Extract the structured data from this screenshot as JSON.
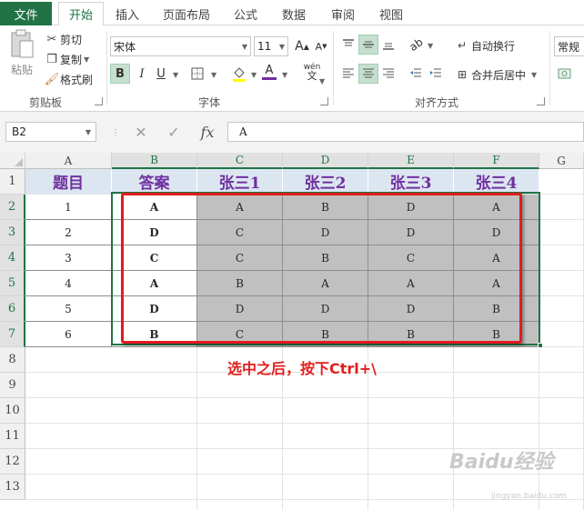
{
  "tabs": [
    "文件",
    "开始",
    "插入",
    "页面布局",
    "公式",
    "数据",
    "审阅",
    "视图"
  ],
  "active_tab": "开始",
  "clipboard": {
    "paste_label": "粘贴",
    "cut_label": "剪切",
    "copy_label": "复制",
    "format_painter_label": "格式刷",
    "group_label": "剪贴板"
  },
  "font": {
    "font_name": "宋体",
    "font_size": "11",
    "bold": "B",
    "italic": "I",
    "underline": "U",
    "grow": "A",
    "shrink": "A",
    "font_color_glyph": "A",
    "phonetic_glyph": "wén",
    "phonetic_sub": "文",
    "group_label": "字体"
  },
  "alignment": {
    "wrap_text_label": "自动换行",
    "merge_center_label": "合并后居中",
    "group_label": "对齐方式"
  },
  "number": {
    "format_label": "常规"
  },
  "formula_bar": {
    "name_box": "B2",
    "fx": "fx",
    "content": "A"
  },
  "columns": [
    "A",
    "B",
    "C",
    "D",
    "E",
    "F",
    "G"
  ],
  "rows": [
    "1",
    "2",
    "3",
    "4",
    "5",
    "6",
    "7",
    "8",
    "9",
    "10",
    "11",
    "12",
    "13"
  ],
  "table": {
    "headers": [
      "题目",
      "答案",
      "张三1",
      "张三2",
      "张三3",
      "张三4"
    ],
    "rows": [
      [
        "1",
        "A",
        "A",
        "B",
        "D",
        "A"
      ],
      [
        "2",
        "D",
        "C",
        "D",
        "D",
        "D"
      ],
      [
        "3",
        "C",
        "C",
        "B",
        "C",
        "A"
      ],
      [
        "4",
        "A",
        "B",
        "A",
        "A",
        "A"
      ],
      [
        "5",
        "D",
        "D",
        "D",
        "D",
        "B"
      ],
      [
        "6",
        "B",
        "C",
        "B",
        "B",
        "B"
      ]
    ]
  },
  "annotation": "选中之后，按下Ctrl+\\",
  "watermark": "Baidu经验",
  "watermark_url": "jingyan.baidu.com",
  "colors": {
    "excel_green": "#217346",
    "header_fill": "#dce6f1",
    "header_text": "#7030a0",
    "selected_fill": "#c0c0c0",
    "annotation_red": "#e11c1c"
  }
}
